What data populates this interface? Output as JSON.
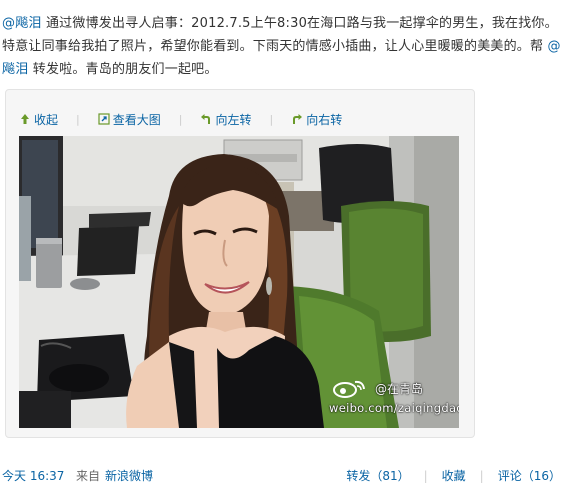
{
  "post": {
    "mention1": "@飚泪",
    "text1": "通过微博发出寻人启事：2012.7.5上午8:30在海口路与我一起撑伞的男生，我在找你。特意让同事给我拍了照片，希望你能看到。下雨天的情感小插曲，让人心里暖暖的美美的。帮",
    "mention2": "@飚泪",
    "text2": "转发啦。青岛的朋友们一起吧。"
  },
  "toolbar": {
    "collapse": "收起",
    "view_large": "查看大图",
    "rotate_left": "向左转",
    "rotate_right": "向右转"
  },
  "watermark": {
    "line1": "@在青岛",
    "line2": "weibo.com/zaiqingdao"
  },
  "footer": {
    "time": "今天  16:37",
    "from": "来自",
    "source": "新浪微博",
    "repost": "转发（81）",
    "favorite": "收藏",
    "comment": "评论（16）"
  },
  "colors": {
    "link": "#0a64a4",
    "box_bg": "#f6f6f6",
    "box_border": "#e3e3e3"
  }
}
